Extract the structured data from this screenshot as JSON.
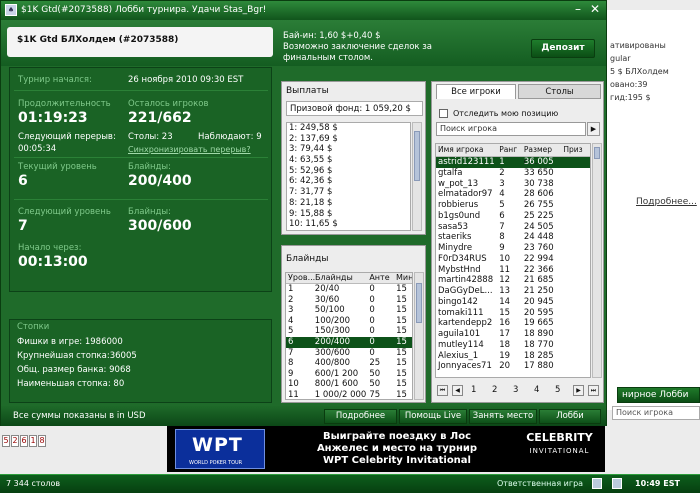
{
  "background": {
    "right_lines": [
      "ативированы",
      "gular",
      "5 $ БЛХолдем",
      "овано:39",
      "гид:195 $"
    ],
    "more_link": "Подробнее...",
    "lobby_button": "нирное Лобби",
    "search_placeholder": "Поиск игрока",
    "digits": [
      "5",
      "2",
      "6",
      "1",
      "8"
    ]
  },
  "taskbar": {
    "tables_count": "7 344 столов",
    "game_status": "Ответственная игра",
    "clock": "10:49 EST"
  },
  "titlebar": {
    "text": "$1K Gtd(#2073588) Лобби турнира. Удачи Stas_Bgr!",
    "minimize": "–",
    "close": "✕"
  },
  "tournament": {
    "name": "$1K Gtd БЛХолдем (#2073588)",
    "buyin_lines": [
      "Бай-ин: 1,60 $+0,40 $",
      "Возможно заключение сделок за",
      "финальным столом."
    ],
    "deposit_label": "Депозит"
  },
  "info": {
    "started_label": "Турнир начался:",
    "started_value": "26 ноября 2010  09:30 EST",
    "duration_label": "Продолжительность",
    "duration_value": "01:19:23",
    "players_left_label": "Осталось игроков",
    "players_left_value": "221/662",
    "next_break_label": "Следующий перерыв:",
    "next_break_value": "00:05:34",
    "tables_label": "Столы: 23",
    "observers_label": "Наблюдают: 9",
    "sync_link": "Синхронизировать перерыв?",
    "current_level_label": "Текущий уровень",
    "current_level_value": "6",
    "blinds_label": "Блайнды:",
    "current_blinds_value": "200/400",
    "next_level_label": "Следующий уровень",
    "next_level_value": "7",
    "next_blinds_label": "Блайнды:",
    "next_blinds_value": "300/600",
    "starts_in_label": "Начало через:",
    "starts_in_value": "00:13:00"
  },
  "stacks": {
    "title": "Стопки",
    "rows": [
      "Фишки в игре:     1986000",
      "Крупнейшая стопка:36005",
      "Общ. размер банка:  9068",
      "Наименьшая стопка:    80"
    ]
  },
  "payouts": {
    "title": "Выплаты",
    "prize_pool": "Призовой фонд: 1 059,20 $",
    "list": [
      "1: 249,58 $",
      "2: 137,69 $",
      "3: 79,44 $",
      "4: 63,55 $",
      "5: 52,96 $",
      "6: 42,36 $",
      "7: 31,77 $",
      "8: 21,18 $",
      "9: 15,88 $",
      "10: 11,65 $"
    ]
  },
  "blinds": {
    "title": "Блайнды",
    "headers": [
      "Уров...",
      "Блайнды",
      "Анте",
      "Мин"
    ],
    "rows": [
      [
        "1",
        "20/40",
        "0",
        "15"
      ],
      [
        "2",
        "30/60",
        "0",
        "15"
      ],
      [
        "3",
        "50/100",
        "0",
        "15"
      ],
      [
        "4",
        "100/200",
        "0",
        "15"
      ],
      [
        "5",
        "150/300",
        "0",
        "15"
      ],
      [
        "6",
        "200/400",
        "0",
        "15"
      ],
      [
        "7",
        "300/600",
        "0",
        "15"
      ],
      [
        "8",
        "400/800",
        "25",
        "15"
      ],
      [
        "9",
        "600/1 200",
        "50",
        "15"
      ],
      [
        "10",
        "800/1 600",
        "50",
        "15"
      ],
      [
        "11",
        "1 000/2 000",
        "75",
        "15"
      ]
    ],
    "selected_index": 5
  },
  "players": {
    "tab_all": "Все игроки",
    "tab_tables": "Столы",
    "track_label": "Отследить мою позицию",
    "search_placeholder": "Поиск игрока",
    "search_button": "▶",
    "headers": [
      "Имя игрока",
      "Ранг",
      "Размер ст...",
      "Приз"
    ],
    "rows": [
      [
        "astrid123111",
        "1",
        "36 005",
        ""
      ],
      [
        "gtalfa",
        "2",
        "33 650",
        ""
      ],
      [
        "w_pot_13",
        "3",
        "30 738",
        ""
      ],
      [
        "elmatador97",
        "4",
        "28 606",
        ""
      ],
      [
        "robbierus",
        "5",
        "26 755",
        ""
      ],
      [
        "b1gs0und",
        "6",
        "25 225",
        ""
      ],
      [
        "sasa53",
        "7",
        "24 505",
        ""
      ],
      [
        "staeriks",
        "8",
        "24 448",
        ""
      ],
      [
        "Minydre",
        "9",
        "23 760",
        ""
      ],
      [
        "F0rD34RUS",
        "10",
        "22 994",
        ""
      ],
      [
        "MybstHnd",
        "11",
        "22 366",
        ""
      ],
      [
        "martin42888",
        "12",
        "21 685",
        ""
      ],
      [
        "DaGGyDeL...",
        "13",
        "21 250",
        ""
      ],
      [
        "bingo142",
        "14",
        "20 945",
        ""
      ],
      [
        "tomaki111",
        "15",
        "20 595",
        ""
      ],
      [
        "kartendepp2",
        "16",
        "19 665",
        ""
      ],
      [
        "aguila101",
        "17",
        "18 890",
        ""
      ],
      [
        "mutley114",
        "18",
        "18 770",
        ""
      ],
      [
        "Alexius_1",
        "19",
        "18 285",
        ""
      ],
      [
        "Jonnyaces71",
        "20",
        "17 880",
        ""
      ]
    ],
    "selected_index": 0,
    "pages": [
      "1",
      "2",
      "3",
      "4",
      "5"
    ]
  },
  "footer": {
    "note": "Все суммы показаны в in USD",
    "buttons": [
      "Подробнее",
      "Помощь Live",
      "Занять место",
      "Лобби"
    ]
  },
  "banner": {
    "wpt_logo": "WPT",
    "wpt_sub": "WORLD POKER TOUR",
    "message_lines": [
      "Выиграйте поездку в Лос",
      "Анжелес и место на турнир",
      "WPT Celebrity Invitational"
    ],
    "celebrity": "CELEBRITY",
    "invitational": "INVITATIONAL"
  },
  "colors": {
    "window_green": "#1f6b2a",
    "selected_row": "#0d5219",
    "label_green": "#7fc98a"
  }
}
